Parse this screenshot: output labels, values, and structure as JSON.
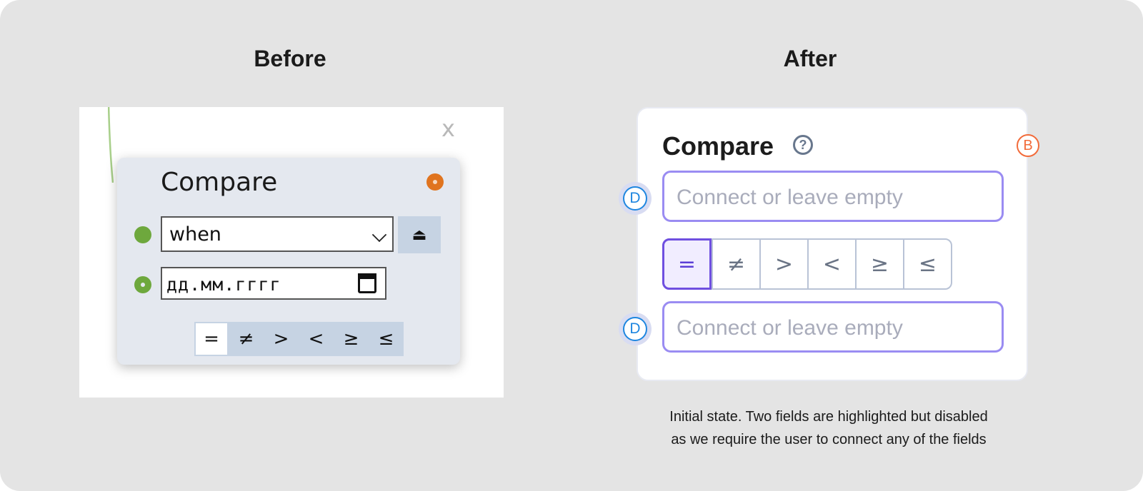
{
  "headings": {
    "before": "Before",
    "after": "After"
  },
  "before": {
    "close_label": "x",
    "title": "Compare",
    "select_value": "when",
    "eject_label": "⏏",
    "date_placeholder": "дд.мм.гггг",
    "operators": [
      "=",
      "≠",
      ">",
      "<",
      "≥",
      "≤"
    ],
    "active_operator_index": 0
  },
  "after": {
    "title": "Compare",
    "help_label": "?",
    "badge_b": "B",
    "badge_d": "D",
    "inputs": [
      {
        "placeholder": "Connect or leave empty"
      },
      {
        "placeholder": "Connect or leave empty"
      }
    ],
    "operators": [
      "=",
      "≠",
      ">",
      "<",
      "≥",
      "≤"
    ],
    "active_operator_index": 0
  },
  "caption": {
    "line1": "Initial state. Two fields are highlighted but disabled",
    "line2": "as we require the user to connect any of the fields"
  },
  "colors": {
    "accent_purple": "#6f4fe0",
    "input_border": "#9a8cf2",
    "badge_orange": "#f26b3a",
    "badge_blue": "#1e86e0",
    "status_green": "#6ea83d"
  }
}
